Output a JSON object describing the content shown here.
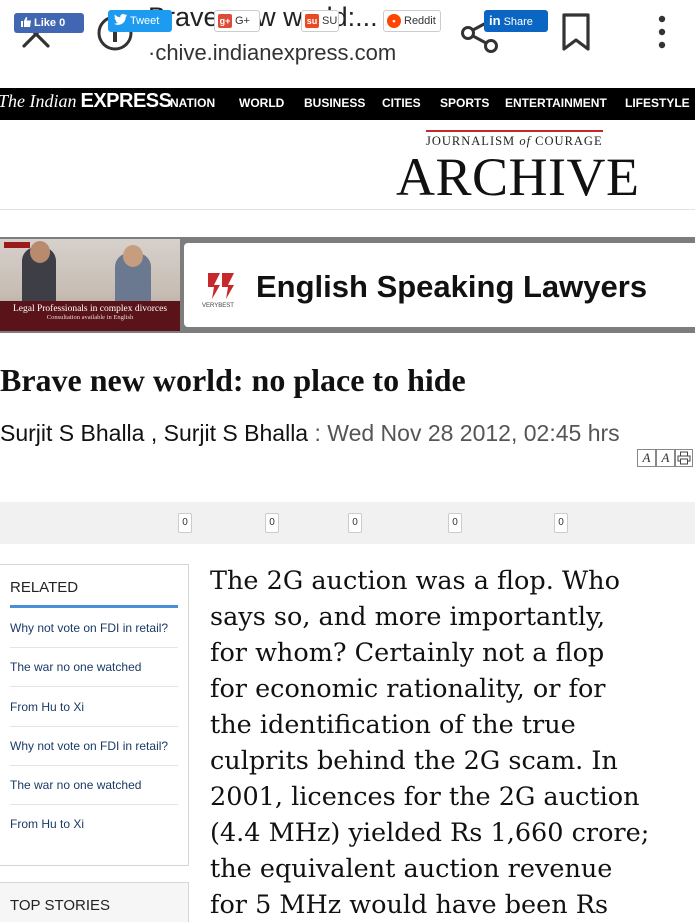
{
  "browser": {
    "page_title": "Brave new world:...",
    "url": "·chive.indianexpress.com"
  },
  "site": {
    "logo_prefix": "The Indian",
    "logo_main": "EXPRESS",
    "nav": [
      "NATION",
      "WORLD",
      "BUSINESS",
      "CITIES",
      "SPORTS",
      "ENTERTAINMENT",
      "LIFESTYLE"
    ],
    "archive_tagline_1": "JOURNALISM",
    "archive_tagline_of": "of",
    "archive_tagline_2": "COURAGE",
    "archive_title": "ARCHIVE"
  },
  "ad": {
    "caption": "Legal Professionals in complex divorces",
    "sub_caption": "Consultation available in English",
    "brand": "VERYBEST",
    "headline": "English Speaking Lawyers"
  },
  "article": {
    "headline": "Brave new world: no place to hide",
    "author_1": "Surjit S Bhalla",
    "author_2": "Surjit S Bhalla",
    "date": "Wed Nov 28 2012, 02:45 hrs",
    "body_lines": [
      "The 2G auction was a flop. Who",
      "says so, and more importantly,",
      "for whom? Certainly not a flop",
      "for economic rationality, or for",
      "the identification of the true",
      "culprits behind the 2G scam. In",
      "2001, licences for the 2G auction",
      "(4.4 MHz) yielded Rs 1,660 crore;",
      "the equivalent auction revenue",
      "for 5 MHz would have been Rs"
    ]
  },
  "font_controls": {
    "smaller": "A",
    "larger": "A"
  },
  "share": {
    "facebook": "Like 0",
    "twitter": "Tweet",
    "twitter_count": "0",
    "google": "G+",
    "google_count": "0",
    "stumble": "SU",
    "stumble_count": "0",
    "reddit": "Reddit",
    "reddit_count": "0",
    "linkedin": "Share",
    "linkedin_count": "0"
  },
  "related": {
    "heading": "RELATED",
    "items": [
      "Why not vote on FDI in retail?",
      "The war no one watched",
      "From Hu to Xi",
      "Why not vote on FDI in retail?",
      "The war no one watched",
      "From Hu to Xi"
    ]
  },
  "top_stories": {
    "heading": "TOP STORIES"
  },
  "colors": {
    "nav_bg": "#000000",
    "accent_red": "#c8282b",
    "facebook": "#4267b2",
    "twitter": "#1d9bf0",
    "linkedin": "#0a66c2",
    "related_link": "#1a3a66"
  }
}
